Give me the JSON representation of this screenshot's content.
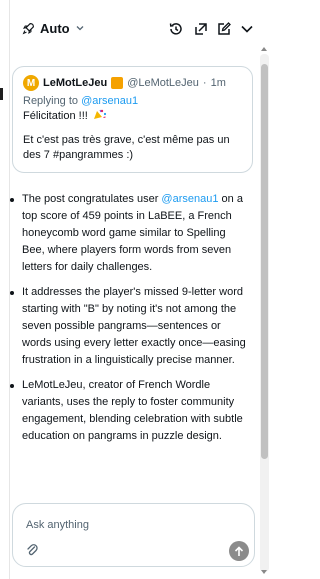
{
  "header": {
    "mode_label": "Auto",
    "icons": [
      "rocket-icon",
      "chevron-down-icon",
      "history-icon",
      "expand-icon",
      "compose-icon",
      "collapse-icon"
    ]
  },
  "tweet": {
    "name": "LeMotLeJeu",
    "handle": "@LeMotLeJeu",
    "separator": "·",
    "time": "1m",
    "replying_prefix": "Replying to",
    "replying_to": "@arsenau1",
    "line1": "Félicitation !!!",
    "line2": "Et c'est pas très grave, c'est même pas un des 7 #pangrammes :)"
  },
  "bullets": [
    {
      "before": "The post congratulates user ",
      "mention": "@arsenau1",
      "after": " on a top score of 459 points in LaBEE, a French honeycomb word game similar to Spelling Bee, where players form words from seven letters for daily challenges."
    },
    {
      "before": "It addresses the player's missed 9-letter word starting with \"B\" by noting it's not among the seven possible pangrams—sentences or words using every letter exactly once—easing frustration in a linguistically precise manner.",
      "mention": "",
      "after": ""
    },
    {
      "before": "LeMotLeJeu, creator of French Wordle variants, uses the reply to foster community engagement, blending celebration with subtle education on pangrams in puzzle design.",
      "mention": "",
      "after": ""
    }
  ],
  "input": {
    "placeholder": "Ask anything"
  },
  "colors": {
    "accent": "#1d9bf0",
    "avatar": "#f0a800",
    "badge": "#f5a100",
    "send": "#8b8b8b"
  }
}
